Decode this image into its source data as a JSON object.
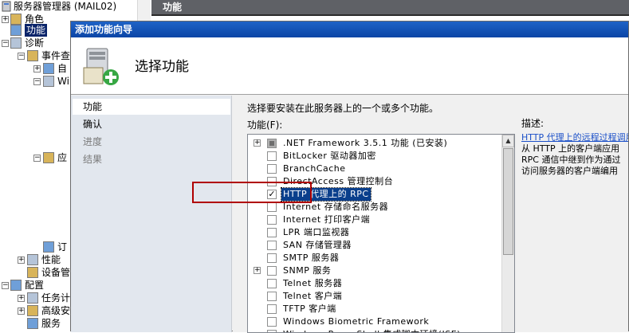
{
  "tree": {
    "root": "服务器管理器 (MAIL02)",
    "items": [
      {
        "label": "角色",
        "exp": "+"
      },
      {
        "label": "功能",
        "exp": "",
        "selected": true
      },
      {
        "label": "诊断",
        "exp": "−"
      },
      {
        "label": "事件查",
        "exp": "−"
      },
      {
        "label": "自",
        "exp": "+"
      },
      {
        "label": "Wi",
        "exp": "−"
      },
      {
        "label": "应",
        "exp": "−"
      },
      {
        "label": "订",
        "exp": ""
      },
      {
        "label": "性能",
        "exp": "+"
      },
      {
        "label": "设备管",
        "exp": ""
      },
      {
        "label": "配置",
        "exp": "−"
      },
      {
        "label": "任务计",
        "exp": "+"
      },
      {
        "label": "高级安",
        "exp": "+"
      },
      {
        "label": "服务",
        "exp": ""
      }
    ]
  },
  "background_header": "功能",
  "wizard": {
    "title": "添加功能向导",
    "banner_title": "选择功能",
    "nav": [
      {
        "label": "功能",
        "state": "active"
      },
      {
        "label": "确认",
        "state": "normal"
      },
      {
        "label": "进度",
        "state": "disabled"
      },
      {
        "label": "结果",
        "state": "disabled"
      }
    ],
    "instruction": "选择要安装在此服务器上的一个或多个功能。",
    "features_label": "功能(F):",
    "description_label": "描述:",
    "features": [
      {
        "label": ".NET Framework 3.5.1 功能  (已安装)",
        "expander": "+",
        "state": "installed"
      },
      {
        "label": "BitLocker 驱动器加密",
        "expander": "",
        "state": "unchecked"
      },
      {
        "label": "BranchCache",
        "expander": "",
        "state": "unchecked"
      },
      {
        "label": "DirectAccess 管理控制台",
        "expander": "",
        "state": "unchecked"
      },
      {
        "label": "HTTP 代理上的 RPC",
        "expander": "",
        "state": "checked",
        "selected": true
      },
      {
        "label": "Internet 存储命名服务器",
        "expander": "",
        "state": "unchecked"
      },
      {
        "label": "Internet 打印客户端",
        "expander": "",
        "state": "unchecked"
      },
      {
        "label": "LPR 端口监视器",
        "expander": "",
        "state": "unchecked"
      },
      {
        "label": "SAN 存储管理器",
        "expander": "",
        "state": "unchecked"
      },
      {
        "label": "SMTP 服务器",
        "expander": "",
        "state": "unchecked"
      },
      {
        "label": "SNMP 服务",
        "expander": "+",
        "state": "unchecked"
      },
      {
        "label": "Telnet 服务器",
        "expander": "",
        "state": "unchecked"
      },
      {
        "label": "Telnet 客户端",
        "expander": "",
        "state": "unchecked"
      },
      {
        "label": "TFTP 客户端",
        "expander": "",
        "state": "unchecked"
      },
      {
        "label": "Windows Biometric Framework",
        "expander": "",
        "state": "unchecked"
      },
      {
        "label": "Windows PowerShell 集成脚本环境(ISE)",
        "expander": "",
        "state": "unchecked"
      }
    ],
    "description": {
      "link": "HTTP 代理上的远程过程调用",
      "lines": [
        "从 HTTP 上的客户端应用",
        "RPC 通信中继到作为通过",
        "访问服务器的客户端编用"
      ]
    },
    "accent_color": "#0a3f8c",
    "highlight_color": "#b00000"
  }
}
